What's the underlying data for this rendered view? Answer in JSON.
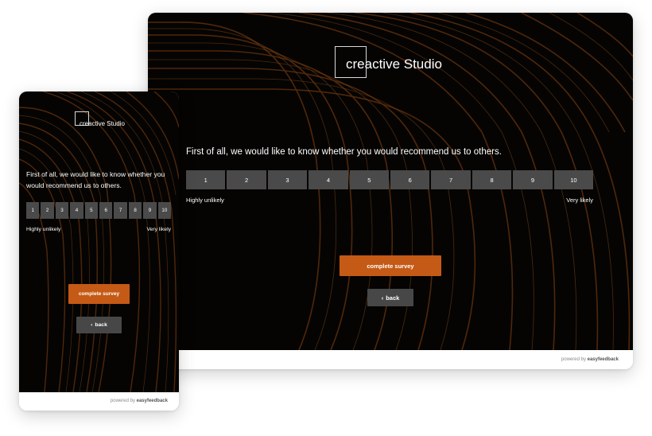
{
  "desktop": {
    "logo_text": "creactive Studio",
    "question": "First of all, we would like to know whether you would recommend us to others.",
    "scale": [
      "1",
      "2",
      "3",
      "4",
      "5",
      "6",
      "7",
      "8",
      "9",
      "10"
    ],
    "scale_low_label": "Highly unlikely",
    "scale_high_label": "Very likely",
    "complete_button": "complete survey",
    "back_button": "back",
    "back_chevron": "‹",
    "footer_prefix": "powered by",
    "footer_brand": "easyfeedback"
  },
  "mobile": {
    "logo_text": "creactive Studio",
    "question": "First of all, we would like to know whether you would recommend us to others.",
    "scale": [
      "1",
      "2",
      "3",
      "4",
      "5",
      "6",
      "7",
      "8",
      "9",
      "10"
    ],
    "scale_low_label": "Highly unlikely",
    "scale_high_label": "Very likely",
    "complete_button": "complete survey",
    "back_button": "back",
    "back_chevron": "‹",
    "footer_prefix": "powered by",
    "footer_brand": "easyfeedback"
  },
  "theme": {
    "accent": "#c45a15",
    "background": "#080605",
    "scale_cell": "#4a4a4a",
    "back_button": "#474747",
    "background_image": "curved-wooden-slats"
  }
}
